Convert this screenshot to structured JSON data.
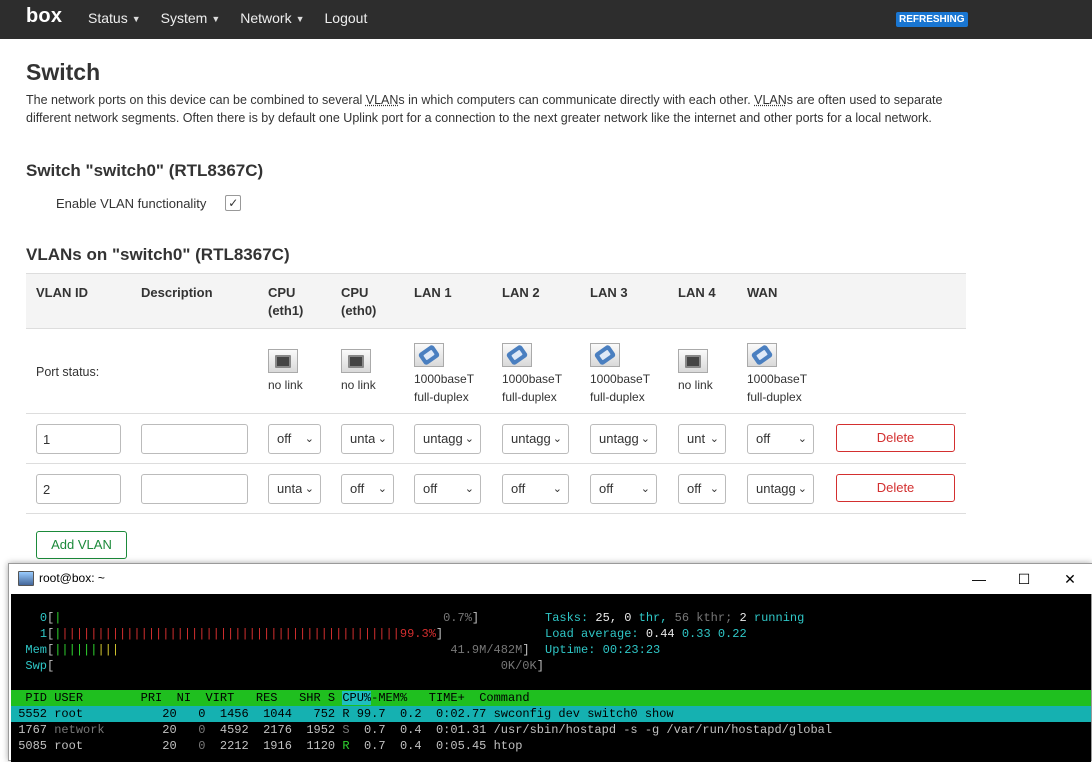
{
  "navbar": {
    "brand": "box",
    "menu": [
      {
        "label": "Status",
        "has_dropdown": true
      },
      {
        "label": "System",
        "has_dropdown": true
      },
      {
        "label": "Network",
        "has_dropdown": true
      },
      {
        "label": "Logout",
        "has_dropdown": false
      }
    ],
    "refresh_badge": "REFRESHING"
  },
  "page": {
    "title": "Switch",
    "description": {
      "part1": "The network ports on this device can be combined to several ",
      "abbr1": "VLAN",
      "part2": "s in which computers can communicate directly with each other. ",
      "abbr2": "VLAN",
      "part3": "s are often used to separate different network segments. Often there is by default one Uplink port for a connection to the next greater network like the internet and other ports for a local network."
    },
    "switch_title": "Switch \"switch0\" (RTL8367C)",
    "vlan_enable_label": "Enable VLAN functionality",
    "vlan_enable_checked": true,
    "vlans_title": "VLANs on \"switch0\" (RTL8367C)",
    "add_vlan_label": "Add VLAN"
  },
  "table": {
    "headers": {
      "vlan_id": "VLAN ID",
      "description": "Description",
      "cpu_eth1_a": "CPU",
      "cpu_eth1_b": "(eth1)",
      "cpu_eth0_a": "CPU",
      "cpu_eth0_b": "(eth0)",
      "lan1": "LAN 1",
      "lan2": "LAN 2",
      "lan3": "LAN 3",
      "lan4": "LAN 4",
      "wan": "WAN"
    },
    "port_status_label": "Port status:",
    "port_status": {
      "cpu_eth1": {
        "line1": "no link",
        "line2": "",
        "linked": false
      },
      "cpu_eth0": {
        "line1": "no link",
        "line2": "",
        "linked": false
      },
      "lan1": {
        "line1": "1000baseT",
        "line2": "full-duplex",
        "linked": true
      },
      "lan2": {
        "line1": "1000baseT",
        "line2": "full-duplex",
        "linked": true
      },
      "lan3": {
        "line1": "1000baseT",
        "line2": "full-duplex",
        "linked": true
      },
      "lan4": {
        "line1": "no link",
        "line2": "",
        "linked": false
      },
      "wan": {
        "line1": "1000baseT",
        "line2": "full-duplex",
        "linked": true
      }
    },
    "rows": [
      {
        "vlan_id": "1",
        "description": "",
        "cpu_eth1": "off",
        "cpu_eth0": "unta",
        "lan1": "untagg",
        "lan2": "untagg",
        "lan3": "untagg",
        "lan4": "unt",
        "wan": "off",
        "delete_label": "Delete"
      },
      {
        "vlan_id": "2",
        "description": "",
        "cpu_eth1": "unta",
        "cpu_eth0": "off",
        "lan1": "off",
        "lan2": "off",
        "lan3": "off",
        "lan4": "off",
        "wan": "untagg",
        "delete_label": "Delete"
      }
    ]
  },
  "terminal": {
    "title": "root@box: ~",
    "win_minimize": "—",
    "win_maximize": "☐",
    "win_close": "✕",
    "cpu0": {
      "label": "0",
      "bar": "|",
      "value": "0.7%"
    },
    "cpu1": {
      "label": "1",
      "bar": "|||||||||||||||||||||||||||||||||||||||||||||||",
      "value": "99.3%"
    },
    "mem": {
      "label": "Mem",
      "bar_green": "||||||",
      "bar_yellow": "|||",
      "value": "41.9M/482M"
    },
    "swp": {
      "label": "Swp",
      "value": "0K/0K"
    },
    "tasks": {
      "label": "Tasks:",
      "count": "25,",
      "thr": "0",
      "thr_label": "thr,",
      "kthr": "56",
      "kthr_label": "kthr;",
      "running": "2",
      "running_label": "running"
    },
    "load": {
      "label": "Load average:",
      "v1": "0.44",
      "v2": "0.33",
      "v3": "0.22"
    },
    "uptime": {
      "label": "Uptime:",
      "value": "00:23:23"
    },
    "proc_header": {
      "pid": "  PID",
      "user": " USER",
      "pri": "PRI",
      "ni": "NI",
      "virt": "VIRT",
      "res": "RES",
      "shr": "SHR",
      "s": "S",
      "cpu": "CPU%",
      "mem": "MEM%",
      "time": "TIME+",
      "command": "Command"
    },
    "processes": [
      {
        "pid": " 5552",
        "user": "root",
        "pri": "20",
        "ni": "0",
        "virt": "1456",
        "res": "1044",
        "shr": "752",
        "s": "R",
        "cpu": "99.7",
        "mem": "0.2",
        "time": "0:02.77",
        "command": "swconfig dev switch0 show"
      },
      {
        "pid": " 1767",
        "user": "network",
        "pri": "20",
        "ni": "0",
        "virt": "4592",
        "res": "2176",
        "shr": "1952",
        "s": "S",
        "cpu": "0.7",
        "mem": "0.4",
        "time": "0:01.31",
        "command": "/usr/sbin/hostapd -s -g /var/run/hostapd/global"
      },
      {
        "pid": " 5085",
        "user": "root",
        "pri": "20",
        "ni": "0",
        "virt": "2212",
        "res": "1916",
        "shr": "1120",
        "s": "R",
        "cpu": "0.7",
        "mem": "0.4",
        "time": "0:05.45",
        "command": "htop"
      }
    ]
  }
}
